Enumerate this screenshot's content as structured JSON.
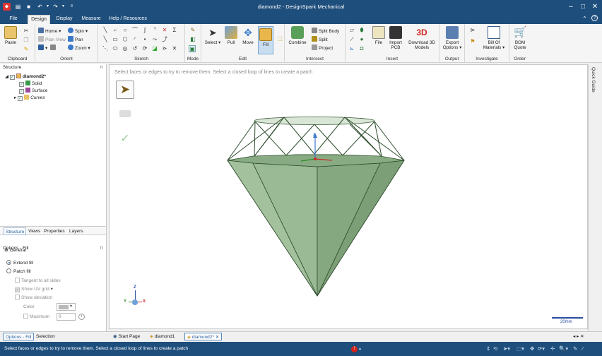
{
  "window": {
    "title": "diamond2 - DesignSpark Mechanical"
  },
  "menu": {
    "tabs": [
      "File",
      "Design",
      "Display",
      "Measure",
      "Help / Resources"
    ],
    "active": "Design"
  },
  "ribbon": {
    "clipboard": {
      "label": "Clipboard",
      "paste": "Paste"
    },
    "orient": {
      "label": "Orient",
      "home": "Home",
      "spin": "Spin",
      "plan_view": "Plan View",
      "pan": "Pan",
      "zoom": "Zoom"
    },
    "sketch": {
      "label": "Sketch"
    },
    "mode": {
      "label": "Mode"
    },
    "edit": {
      "label": "Edit",
      "select": "Select",
      "pull": "Pull",
      "move": "Move",
      "fill": "Fill"
    },
    "intersect": {
      "label": "Intersect",
      "combine": "Combine",
      "split_body": "Split Body",
      "split": "Split",
      "project": "Project"
    },
    "insert": {
      "label": "Insert",
      "file": "File",
      "import_pcb_1": "Import",
      "import_pcb_2": "PCB",
      "download_1": "Download 3D",
      "download_2": "Models"
    },
    "output": {
      "label": "Output",
      "export_1": "Export",
      "export_2": "Options ▾"
    },
    "investigate": {
      "label": "Investigate",
      "bom_1": "Bill Of",
      "bom_2": "Materials ▾"
    },
    "order": {
      "label": "Order",
      "quote_1": "BOM",
      "quote_2": "Quote"
    }
  },
  "structure": {
    "header": "Structure",
    "root": "diamond2*",
    "items": [
      "Solid",
      "Surface",
      "Curves"
    ]
  },
  "panel_tabs": [
    "Structure",
    "Views",
    "Properties",
    "Layers"
  ],
  "options": {
    "header": "Options - Fill",
    "general": "General",
    "extend_fill": "Extend fill",
    "patch_fill": "Patch fill",
    "tangent": "Tangent to all sides",
    "show_uv": "Show UV grid",
    "show_dev": "Show deviation",
    "color_label": "Color",
    "maximum_label": "Maximum",
    "maximum_value": "0"
  },
  "viewport": {
    "hint": "Select faces or edges to try to remove them. Select a closed loop of lines to create a patch",
    "scale": "20mm",
    "triad": {
      "x": "X",
      "y": "Y",
      "z": "Z"
    },
    "model_color": "#8fb08a"
  },
  "right_strip": {
    "label": "Quick Guide"
  },
  "bottom_tabs": {
    "left1": "Options - Fill",
    "left2": "Selection",
    "docs": [
      "Start Page",
      "diamond1",
      "diamond2*"
    ],
    "active_doc": "diamond2*"
  },
  "status": {
    "text": "Select faces or edges to try to remove them. Select a closed loop of lines to create a patch"
  }
}
